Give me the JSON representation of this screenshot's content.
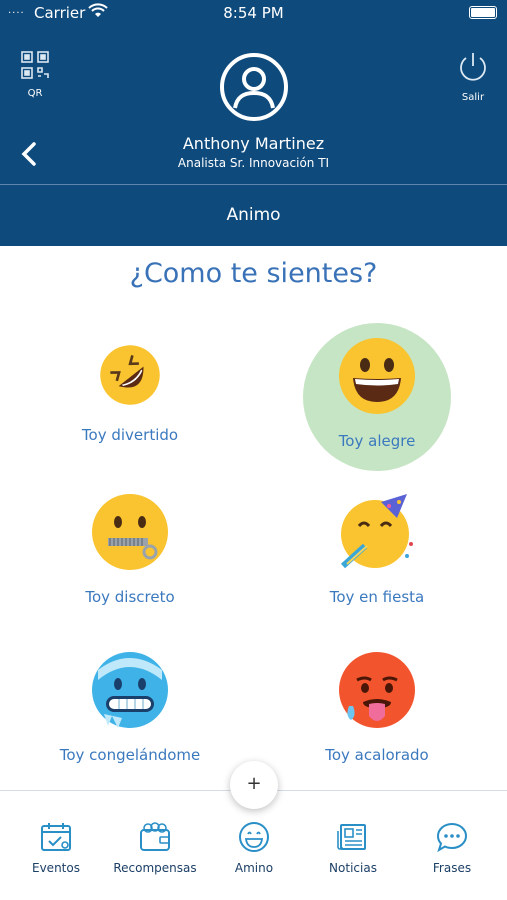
{
  "status_bar": {
    "signal": "....",
    "carrier": "Carrier",
    "time": "8:54 PM"
  },
  "header": {
    "qr_label": "QR",
    "logout_label": "Salir",
    "user_name": "Anthony Martinez",
    "user_role": "Analista Sr. Innovación TI",
    "section_title": "Animo"
  },
  "question": "¿Como te sientes?",
  "moods": [
    {
      "label": "Toy divertido",
      "icon": "laughing-face-icon",
      "selected": false
    },
    {
      "label": "Toy alegre",
      "icon": "grinning-face-icon",
      "selected": true
    },
    {
      "label": "Toy discreto",
      "icon": "zipper-mouth-face-icon",
      "selected": false
    },
    {
      "label": "Toy en fiesta",
      "icon": "partying-face-icon",
      "selected": false
    },
    {
      "label": "Toy congelándome",
      "icon": "freezing-face-icon",
      "selected": false
    },
    {
      "label": "Toy acalorado",
      "icon": "hot-face-icon",
      "selected": false
    }
  ],
  "fab_label": "+",
  "tabs": [
    {
      "label": "Eventos",
      "icon": "calendar-icon"
    },
    {
      "label": "Recompensas",
      "icon": "wallet-icon"
    },
    {
      "label": "Amino",
      "icon": "smiley-icon"
    },
    {
      "label": "Noticias",
      "icon": "newspaper-icon"
    },
    {
      "label": "Frases",
      "icon": "chat-bubble-icon"
    }
  ],
  "colors": {
    "header_bg": "#0e4a7c",
    "accent_blue": "#3a72b8",
    "selected_bg": "#c6e5c4",
    "tab_icon": "#2b8fc7"
  }
}
